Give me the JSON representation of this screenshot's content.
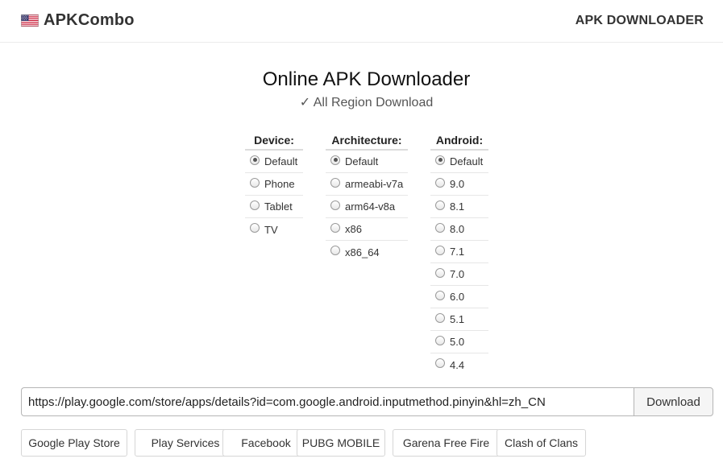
{
  "header": {
    "brand": "APKCombo",
    "brand_icon": "us-flag-icon",
    "nav_link": "APK DOWNLOADER"
  },
  "main": {
    "title": "Online APK Downloader",
    "subtitle": "✓ All Region Download"
  },
  "options": {
    "device": {
      "label": "Device:",
      "selected": "Default",
      "items": [
        "Default",
        "Phone",
        "Tablet",
        "TV"
      ]
    },
    "architecture": {
      "label": "Architecture:",
      "selected": "Default",
      "items": [
        "Default",
        "armeabi-v7a",
        "arm64-v8a",
        "x86",
        "x86_64"
      ]
    },
    "android": {
      "label": "Android:",
      "selected": "Default",
      "items": [
        "Default",
        "9.0",
        "8.1",
        "8.0",
        "7.1",
        "7.0",
        "6.0",
        "5.1",
        "5.0",
        "4.4"
      ]
    }
  },
  "search": {
    "url_value": "https://play.google.com/store/apps/details?id=com.google.android.inputmethod.pinyin&hl=zh_CN",
    "download_label": "Download"
  },
  "quick_links": [
    "Google Play Store",
    "Play Services",
    "Facebook",
    "PUBG MOBILE",
    "Garena Free Fire",
    "Clash of Clans"
  ],
  "colors": {
    "border": "#b5b5b5",
    "button_bg": "#f5f5f5",
    "divider": "#e6e6e6"
  }
}
